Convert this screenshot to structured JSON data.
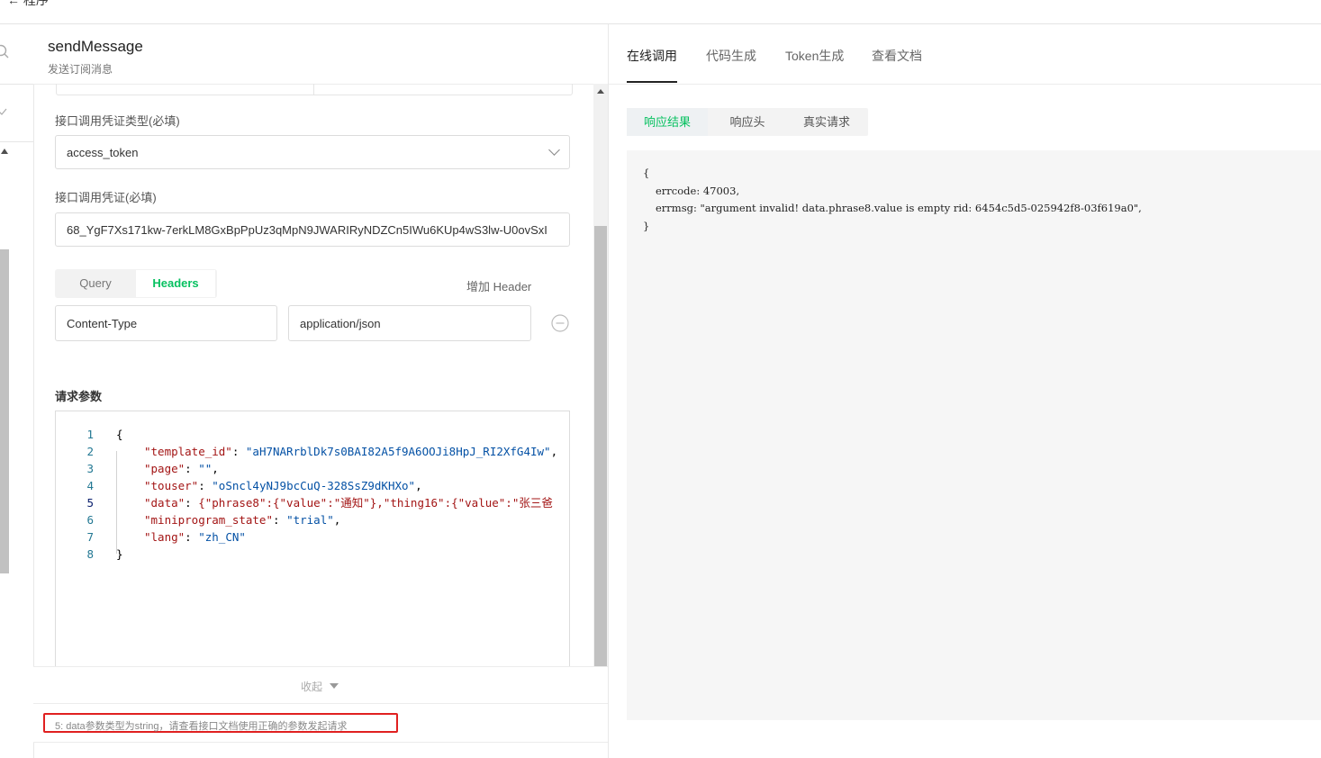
{
  "left_panel": {
    "title": "sendMessage",
    "subtitle": "发送订阅消息",
    "credential_type_label": "接口调用凭证类型(必填)",
    "credential_type_value": "access_token",
    "credential_label": "接口调用凭证(必填)",
    "credential_value": "68_YgF7Xs171kw-7erkLM8GxBpPpUz3qMpN9JWARIRyNDZCn5IWu6KUp4wS3lw-U0ovSxI",
    "tabs": [
      "Query",
      "Headers"
    ],
    "add_header_label": "增加 Header",
    "header_key": "Content-Type",
    "header_value": "application/json",
    "params_label": "请求参数",
    "collapse_label": "收起",
    "status_message": "5: data参数类型为string，请查看接口文档使用正确的参数发起请求"
  },
  "code_lines": [
    {
      "num": "1",
      "text": "{"
    },
    {
      "num": "2",
      "key": "\"template_id\"",
      "sep": ": ",
      "val": "\"aH7NARrblDk7s0BAI82A5f9A6OOJi8HpJ_RI2XfG4Iw\"",
      "end": ","
    },
    {
      "num": "3",
      "key": "\"page\"",
      "sep": ": ",
      "val": "\"\"",
      "end": ","
    },
    {
      "num": "4",
      "key": "\"touser\"",
      "sep": ": ",
      "val": "\"oSncl4yNJ9bcCuQ-328SsZ9dKHXo\"",
      "end": ","
    },
    {
      "num": "5",
      "key": "\"data\"",
      "sep": ": ",
      "val": "{\"phrase8\":{\"value\":\"通知\"},\"thing16\":{\"value\":\"张三爸",
      "end": ""
    },
    {
      "num": "6",
      "key": "\"miniprogram_state\"",
      "sep": ": ",
      "val": "\"trial\"",
      "end": ","
    },
    {
      "num": "7",
      "key": "\"lang\"",
      "sep": ": ",
      "val": "\"zh_CN\"",
      "end": ""
    },
    {
      "num": "8",
      "text": "}"
    }
  ],
  "right_panel": {
    "tabs": [
      "在线调用",
      "代码生成",
      "Token生成",
      "查看文档"
    ],
    "sub_tabs": [
      "响应结果",
      "响应头",
      "真实请求"
    ],
    "response": {
      "open": "{",
      "errcode_line": "errcode: 47003,",
      "errmsg_line": "errmsg: \"argument invalid! data.phrase8.value is empty rid: 6454c5d5-025942f8-03f619a0\",",
      "close": "}"
    }
  },
  "colors": {
    "accent": "#07c160",
    "error_box": "#e02020"
  },
  "icons": [
    "search-icon",
    "chevron-down-icon",
    "remove-circle-icon",
    "caret-down-icon"
  ]
}
